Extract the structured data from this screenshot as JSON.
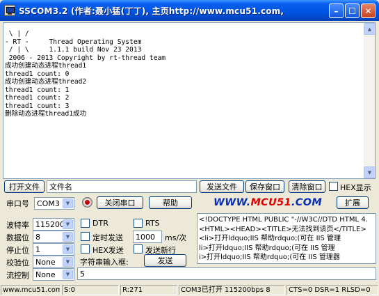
{
  "window": {
    "title": "SSCOM3.2 (作者:聂小猛(丁丁), 主页http://www.mcu51.com,",
    "min_glyph": "–",
    "max_glyph": "☐",
    "close_glyph": "✕"
  },
  "receive": {
    "text": " \\ | /\n- RT -     Thread Operating System\n / | \\     1.1.1 build Nov 23 2013\n 2006 - 2013 Copyright by rt-thread team\n成功创建动态进程thread1\nthread1 count: 0\n成功创建动态进程thread2\nthread1 count: 1\nthread1 count: 2\nthread1 count: 3\n删除动态进程thread1成功"
  },
  "toolbar": {
    "open_file": "打开文件",
    "file_name": "文件名",
    "send_file": "发送文件",
    "save_window": "保存窗口",
    "clear_window": "清除窗口",
    "hex_display": "HEX显示"
  },
  "port": {
    "label": "串口号",
    "value": "COM3",
    "close_port": "关闭串口",
    "help": "帮助",
    "expand": "扩展"
  },
  "logo": {
    "prefix": "WWW.",
    "number": "MCU51",
    "suffix": ".COM"
  },
  "settings": {
    "baud_label": "波特率",
    "baud_value": "115200",
    "data_bits_label": "数据位",
    "data_bits_value": "8",
    "stop_bits_label": "停止位",
    "stop_bits_value": "1",
    "parity_label": "校验位",
    "parity_value": "None",
    "flow_label": "流控制",
    "flow_value": "None"
  },
  "options": {
    "dtr": "DTR",
    "rts": "RTS",
    "timed_send": "定时发送",
    "interval": "1000",
    "interval_unit": "ms/次",
    "hex_send": "HEX发送",
    "send_newline": "发送新行",
    "char_input_label": "字符串输入框:",
    "send": "发送"
  },
  "send_box": {
    "text": "<!DOCTYPE HTML PUBLIC \"-//W3C//DTD HTML 4.\n<HTML><HEAD><TITLE>无法找到该页</TITLE>\n<li>打开ldquo;IIS 帮助rdquo;(可在 IIS 管理\nli>打开ldquo;IIS 帮助rdquo;(可在 IIS 管理\ni>打开ldquo;IIS 帮助rdquo;(可在 IIS 管理器"
  },
  "send_line": {
    "value": "5"
  },
  "status": {
    "site": "www.mcu51.com",
    "sent": "S:0",
    "received": "R:271",
    "port_state": "COM3已打开  115200bps  8",
    "signals": "CTS=0 DSR=1 RLSD=0"
  }
}
